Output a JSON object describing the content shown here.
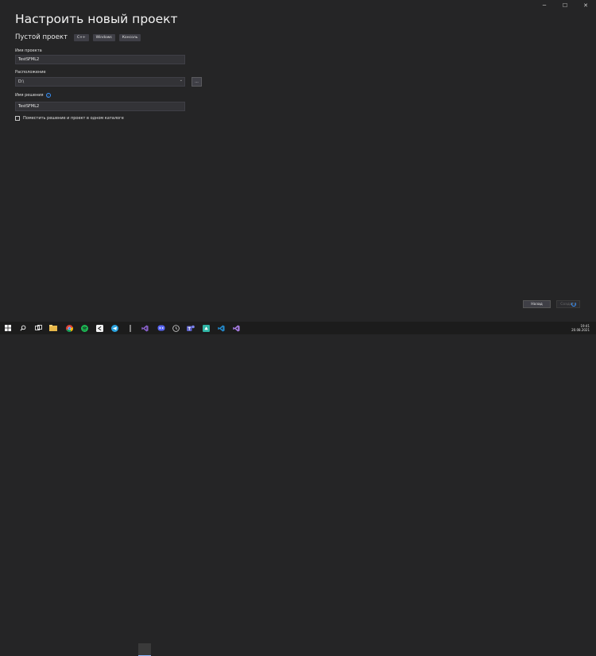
{
  "window": {
    "controls": {
      "minimize": "─",
      "maximize": "☐",
      "close": "✕"
    }
  },
  "page_title": "Настроить новый проект",
  "template": {
    "name": "Пустой проект",
    "tags": [
      "C++",
      "Windows",
      "Консоль"
    ]
  },
  "project_name": {
    "label": "Имя проекта",
    "value": "TestSFML2"
  },
  "location": {
    "label": "Расположение",
    "value": "D:\\",
    "browse_label": "..."
  },
  "solution_name": {
    "label": "Имя решения",
    "value": "TestSFML2"
  },
  "same_dir_checkbox": {
    "label": "Поместить решение и проект в одном каталоге",
    "checked": false
  },
  "buttons": {
    "back": "Назад",
    "create": "Создать"
  },
  "taskbar": {
    "time": "19:41",
    "date": "20.08.2021",
    "icons": [
      "windows-icon",
      "search-icon",
      "task-view-icon",
      "file-explorer-icon",
      "chrome-icon",
      "spotify-icon",
      "capcut-icon",
      "telegram-icon",
      "visual-studio-icon",
      "discord-icon",
      "clock-icon",
      "teams-icon",
      "app-icon",
      "vscode-icon",
      "visual-studio-2-icon"
    ]
  },
  "colors": {
    "accent": "#3794ff",
    "background": "#252526",
    "vs_purple": "#865fc5"
  }
}
